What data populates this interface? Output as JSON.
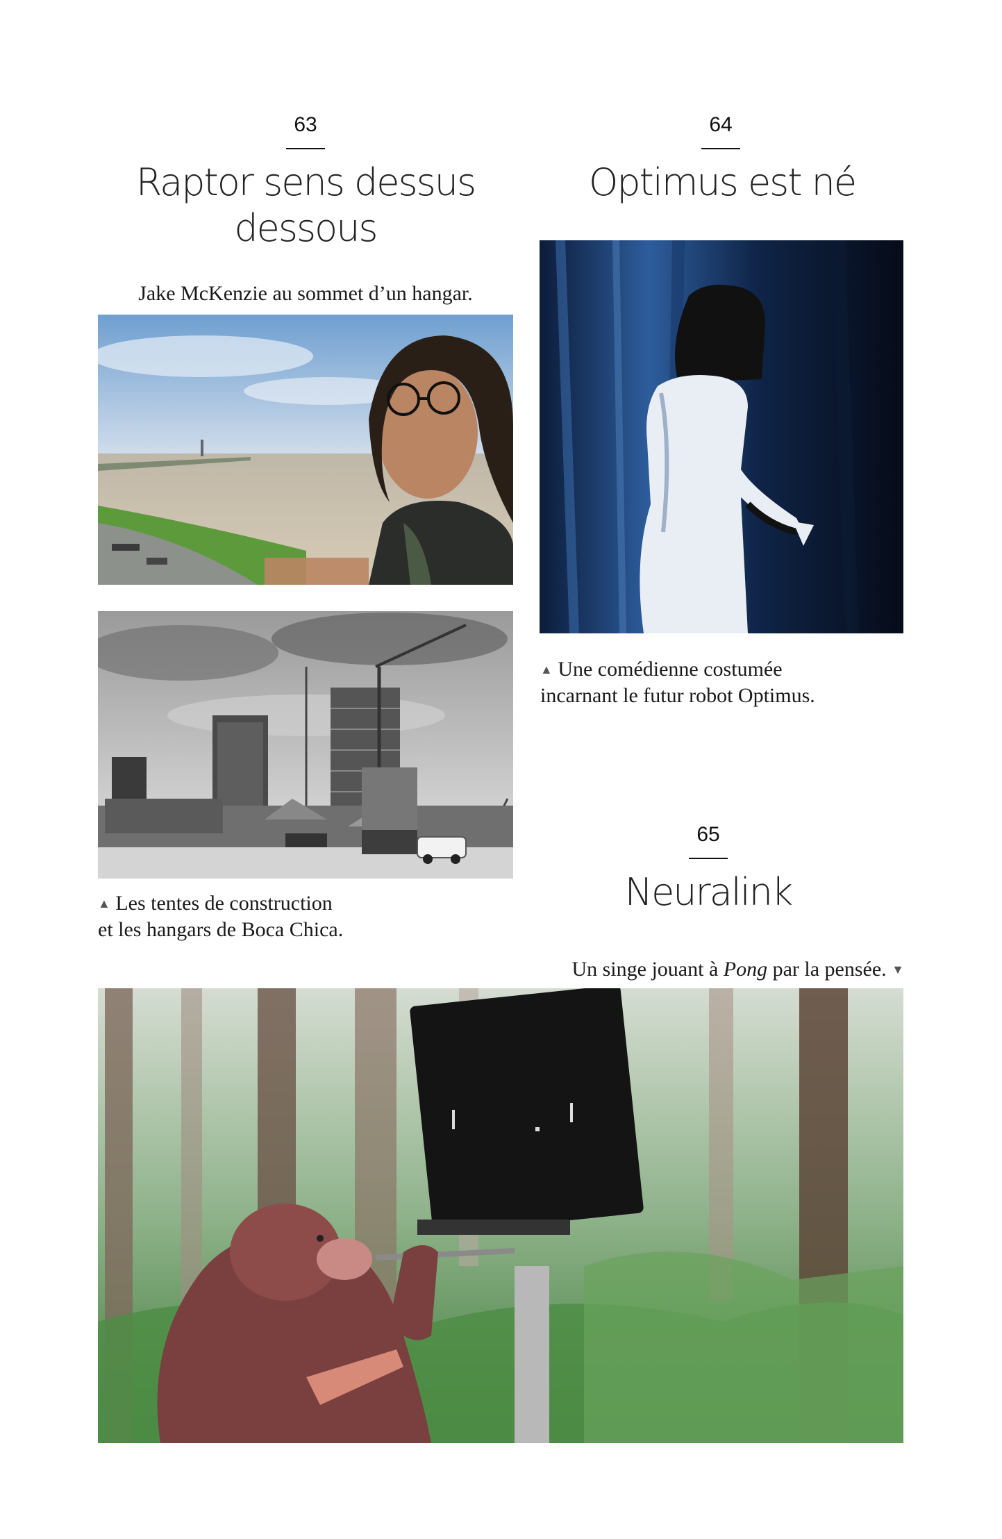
{
  "chapter_63": {
    "number": "63",
    "title_line1": "Raptor sens dessus",
    "title_line2": "dessous",
    "caption_top": "Jake McKenzie au sommet d’un hangar.",
    "caption_bottom_line1": "Les tentes de construction",
    "caption_bottom_line2": "et les hangars de Boca Chica."
  },
  "chapter_64": {
    "number": "64",
    "title": "Optimus est né",
    "caption_line1": "Une comédienne costumée",
    "caption_line2": "incarnant le futur robot Optimus."
  },
  "chapter_65": {
    "number": "65",
    "title": "Neuralink",
    "caption_before": "Un singe jouant à ",
    "caption_italic": "Pong",
    "caption_after": " par la pensée."
  },
  "icons": {
    "caption_up": "triangle-up-icon",
    "caption_down": "triangle-down-icon"
  },
  "colors": {
    "text": "#1a1a1a",
    "rule": "#111111"
  }
}
